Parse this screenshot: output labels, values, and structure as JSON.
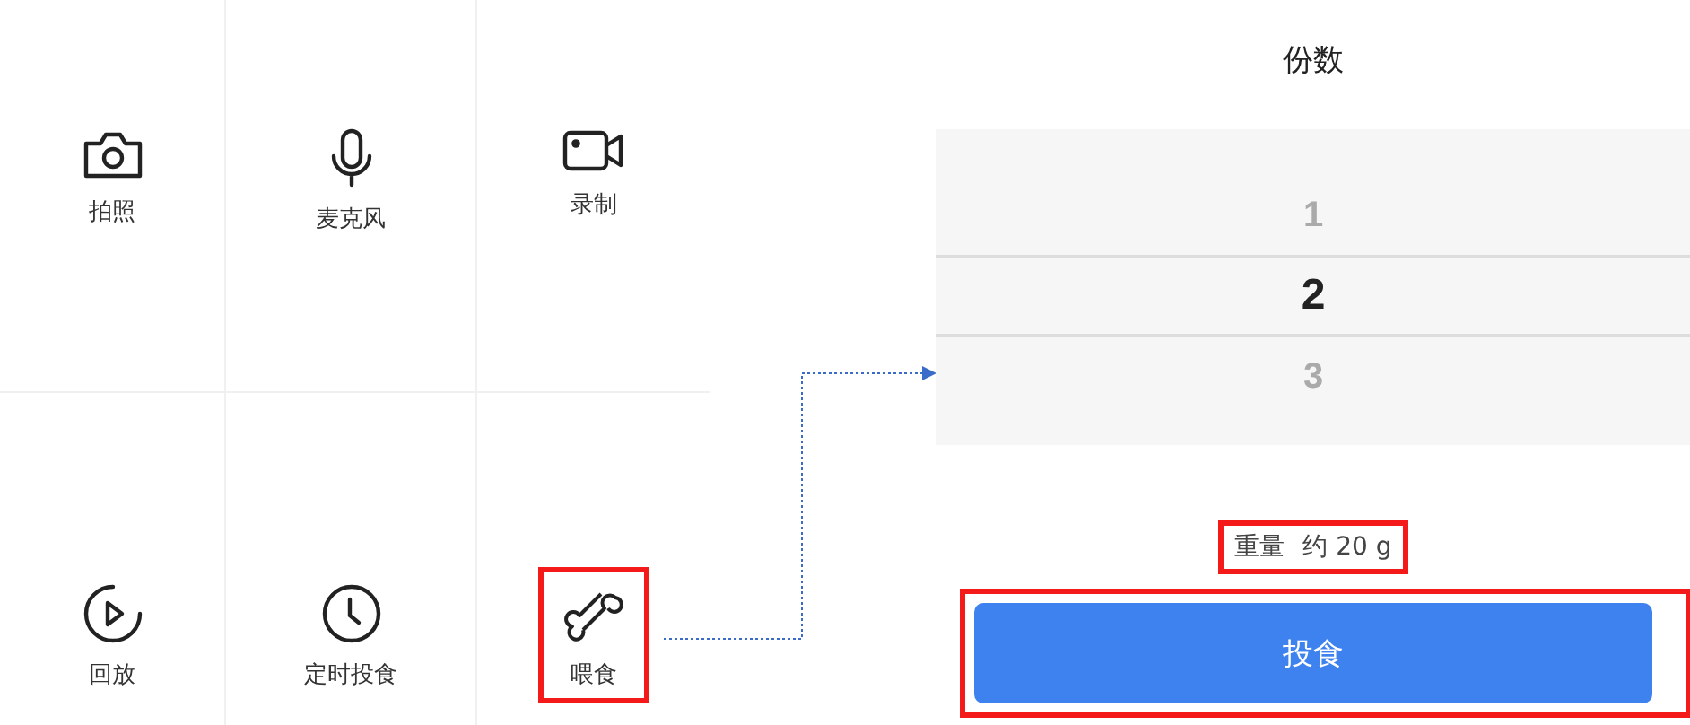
{
  "functions": [
    {
      "kind": "camera",
      "label": "拍照",
      "highlighted": false
    },
    {
      "kind": "microphone",
      "label": "麦克风",
      "highlighted": false
    },
    {
      "kind": "video",
      "label": "录制",
      "highlighted": false
    },
    {
      "kind": "playback",
      "label": "回放",
      "highlighted": false
    },
    {
      "kind": "clock",
      "label": "定时投食",
      "highlighted": false
    },
    {
      "kind": "bone",
      "label": "喂食",
      "highlighted": true
    }
  ],
  "portions": {
    "title": "份数",
    "options": [
      {
        "label": "1",
        "selected": false
      },
      {
        "label": "2",
        "selected": true
      },
      {
        "label": "3",
        "selected": false
      }
    ]
  },
  "weight": {
    "label": "重量",
    "value": "约 20 g",
    "highlighted": true
  },
  "feed_button": {
    "label": "投食",
    "highlighted": true
  }
}
